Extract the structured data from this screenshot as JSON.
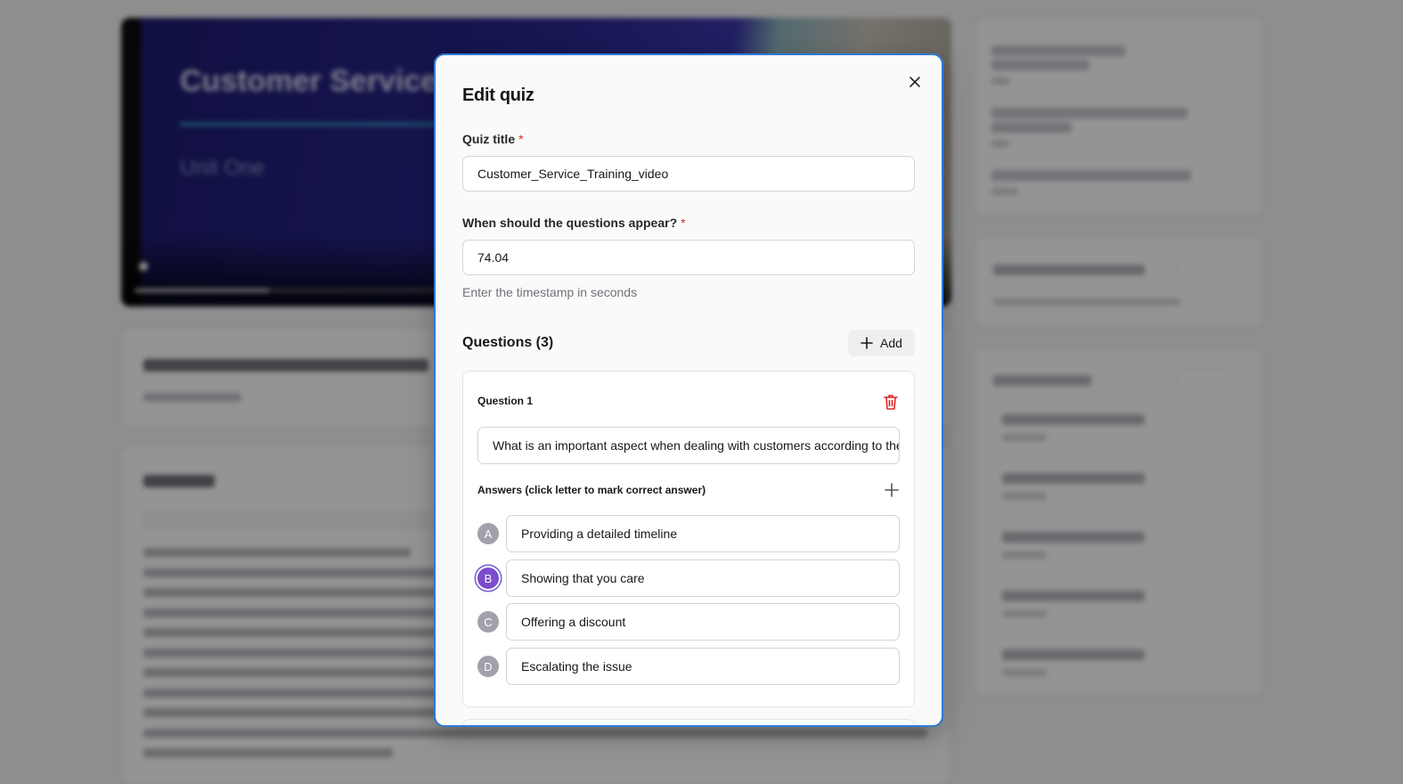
{
  "modal": {
    "title": "Edit quiz",
    "quiz_title_label": "Quiz title",
    "required_mark": "*",
    "quiz_title_value": "Customer_Service_Training_video",
    "timing_label": "When should the questions appear?",
    "timing_value": "74.04",
    "timing_helper": "Enter the timestamp in seconds",
    "questions_heading": "Questions (3)",
    "add_label": "Add",
    "question": {
      "label": "Question 1",
      "text": "What is an important aspect when dealing with customers according to the video?",
      "answers_label": "Answers (click letter to mark correct answer)",
      "answers": [
        {
          "letter": "A",
          "text": "Providing a detailed timeline",
          "correct": false
        },
        {
          "letter": "B",
          "text": "Showing that you care",
          "correct": true
        },
        {
          "letter": "C",
          "text": "Offering a discount",
          "correct": false
        },
        {
          "letter": "D",
          "text": "Escalating the issue",
          "correct": false
        }
      ]
    }
  },
  "background": {
    "video_title": "Customer Service",
    "video_subtitle": "Unit One"
  },
  "colors": {
    "accent": "#2f7ad6",
    "correct_answer": "#7c4dcc",
    "danger": "#dc2626"
  }
}
